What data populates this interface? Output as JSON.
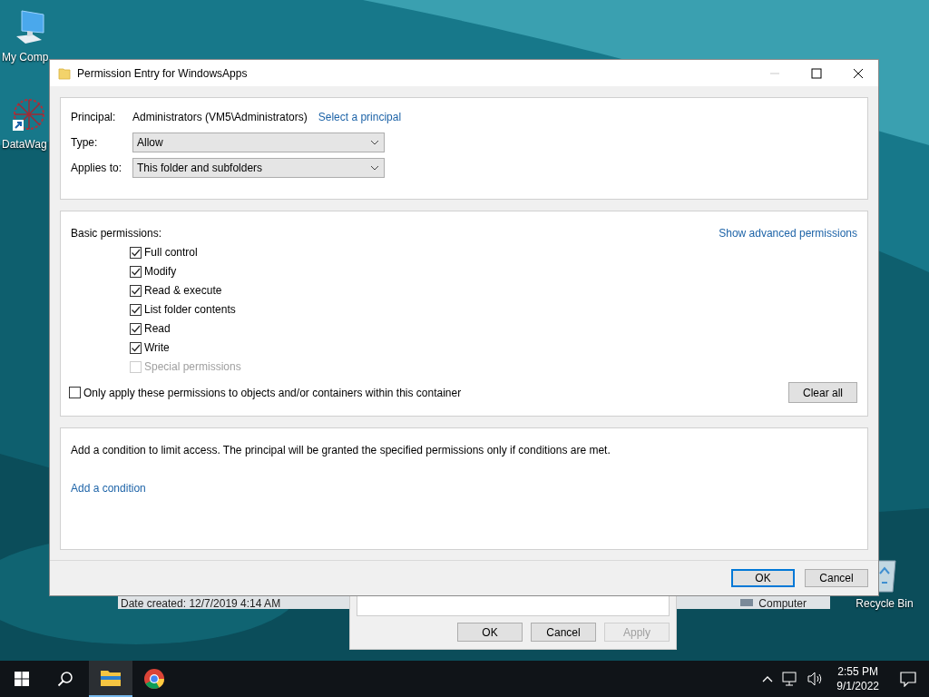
{
  "desktop": {
    "icons": [
      {
        "label": "My Comp",
        "kind": "computer"
      },
      {
        "label": "DataWag",
        "kind": "shortcut"
      },
      {
        "label": "Recycle Bin",
        "kind": "recycle"
      }
    ]
  },
  "background_window": {
    "date_created": "Date created: 12/7/2019 4:14 AM",
    "item": "Computer"
  },
  "properties_dialog": {
    "buttons": [
      {
        "label": "OK",
        "disabled": false
      },
      {
        "label": "Cancel",
        "disabled": false
      },
      {
        "label": "Apply",
        "disabled": true
      }
    ]
  },
  "dialog": {
    "title": "Permission Entry for WindowsApps",
    "minimize_disabled": true,
    "principal": {
      "label": "Principal:",
      "value": "Administrators (VM5\\Administrators)",
      "link": "Select a principal"
    },
    "type": {
      "label": "Type:",
      "value": "Allow"
    },
    "applies_to": {
      "label": "Applies to:",
      "value": "This folder and subfolders"
    },
    "basic_permissions": {
      "label": "Basic permissions:",
      "link": "Show advanced permissions",
      "items": [
        {
          "label": "Full control",
          "checked": true,
          "disabled": false
        },
        {
          "label": "Modify",
          "checked": true,
          "disabled": false
        },
        {
          "label": "Read & execute",
          "checked": true,
          "disabled": false
        },
        {
          "label": "List folder contents",
          "checked": true,
          "disabled": false
        },
        {
          "label": "Read",
          "checked": true,
          "disabled": false
        },
        {
          "label": "Write",
          "checked": true,
          "disabled": false
        },
        {
          "label": "Special permissions",
          "checked": false,
          "disabled": true
        }
      ]
    },
    "only_apply": {
      "label": "Only apply these permissions to objects and/or containers within this container",
      "checked": false
    },
    "clear_all": "Clear all",
    "condition": {
      "text": "Add a condition to limit access. The principal will be granted the specified permissions only if conditions are met.",
      "link": "Add a condition"
    },
    "buttons": [
      {
        "label": "OK",
        "default": true
      },
      {
        "label": "Cancel",
        "default": false
      }
    ]
  },
  "taskbar": {
    "apps": [
      {
        "kind": "explorer",
        "active": true
      },
      {
        "kind": "chrome",
        "active": false
      }
    ],
    "time": "2:55 PM",
    "date": "9/1/2022"
  }
}
